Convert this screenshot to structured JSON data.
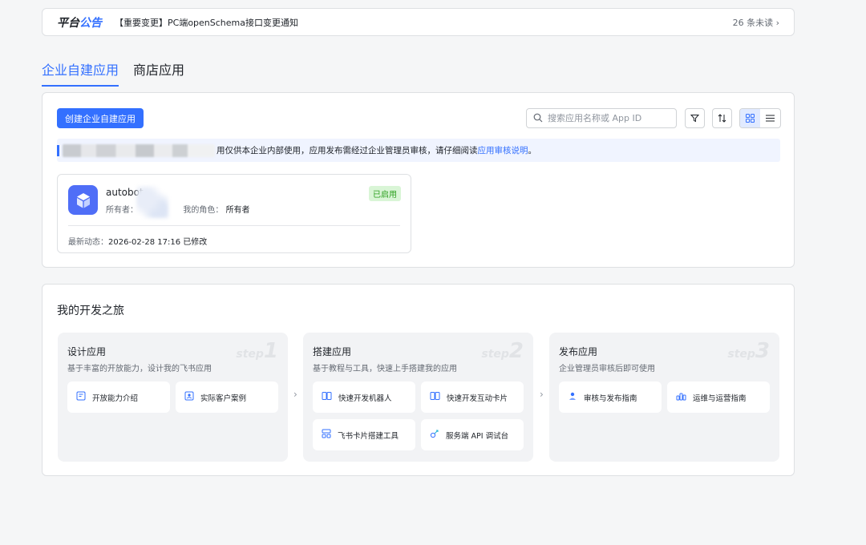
{
  "announcement": {
    "logo_part1": "平台",
    "logo_part2": "公告",
    "text": "【重要变更】PC端openSchema接口变更通知",
    "unread": "26 条未读 ›"
  },
  "tabs": [
    {
      "label": "企业自建应用",
      "active": true
    },
    {
      "label": "商店应用",
      "active": false
    }
  ],
  "apps": {
    "create_button": "创建企业自建应用",
    "search_placeholder": "搜索应用名称或 App ID",
    "info_text": "用仅供本企业内部使用，应用发布需经过企业管理员审核，请仔细阅读 ",
    "info_link": "应用审核说明",
    "info_suffix": "。",
    "app": {
      "name": "autobot",
      "owner_label": "所有者：",
      "role_label": "我的角色：",
      "role_value": "所有者",
      "status": "已启用",
      "activity_label": "最新动态：",
      "activity_value": "2026-02-28 17:16 已修改"
    }
  },
  "journey": {
    "title": "我的开发之旅",
    "steps": [
      {
        "title": "设计应用",
        "desc": "基于丰富的开放能力，设计我的飞书应用",
        "wm_word": "step",
        "wm_num": "1",
        "items": [
          "开放能力介绍",
          "实际客户案例"
        ]
      },
      {
        "title": "搭建应用",
        "desc": "基于教程与工具，快速上手搭建我的应用",
        "wm_word": "step",
        "wm_num": "2",
        "items": [
          "快速开发机器人",
          "快速开发互动卡片",
          "飞书卡片搭建工具",
          "服务端 API 调试台"
        ]
      },
      {
        "title": "发布应用",
        "desc": "企业管理员审核后即可使用",
        "wm_word": "step",
        "wm_num": "3",
        "items": [
          "审核与发布指南",
          "运维与运营指南"
        ]
      }
    ]
  },
  "colors": {
    "accent": "#3370ff",
    "success_bg": "#d9f5d6",
    "success_text": "#2ea121",
    "app_icon": "#4f6ef7"
  }
}
